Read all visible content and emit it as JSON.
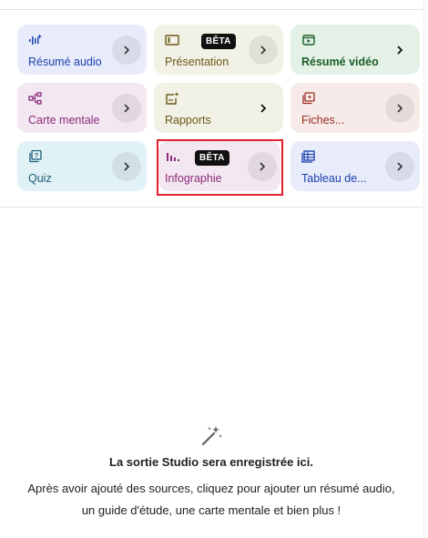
{
  "tiles": [
    {
      "label": "Résumé audio",
      "icon": "audio-waveform-icon",
      "beta": "",
      "bg": "#e8ecfa",
      "color": "#1a3fae"
    },
    {
      "label": "Présentation",
      "icon": "slides-icon",
      "beta": "BÊTA",
      "bg": "#f1f1e5",
      "color": "#6b5a17"
    },
    {
      "label": "Résumé vidéo",
      "icon": "video-icon",
      "beta": "",
      "bg": "#e4f1e6",
      "color": "#1a5e2a"
    },
    {
      "label": "Carte mentale",
      "icon": "mind-map-icon",
      "beta": "",
      "bg": "#f3e8f1",
      "color": "#8d2a7c"
    },
    {
      "label": "Rapports",
      "icon": "reports-icon",
      "beta": "",
      "bg": "#f1f1e5",
      "color": "#6b5a17"
    },
    {
      "label": "Fiches...",
      "icon": "flashcards-icon",
      "beta": "",
      "bg": "#f7ebe9",
      "color": "#9b2d22"
    },
    {
      "label": "Quiz",
      "icon": "quiz-icon",
      "beta": "",
      "bg": "#e1f2f7",
      "color": "#1a5c74"
    },
    {
      "label": "Infographie",
      "icon": "infographic-icon",
      "beta": "BÊTA",
      "bg": "#f3e8f1",
      "color": "#8d2a7c"
    },
    {
      "label": "Tableau de...",
      "icon": "table-icon",
      "beta": "",
      "bg": "#e8ecfa",
      "color": "#1a3fae"
    }
  ],
  "empty": {
    "icon": "magic-wand-icon",
    "title": "La sortie Studio sera enregistrée ici.",
    "line1": "Après avoir ajouté des sources, cliquez pour ajouter un résumé audio,",
    "line2": "un guide d'étude, une carte mentale et bien plus !"
  }
}
